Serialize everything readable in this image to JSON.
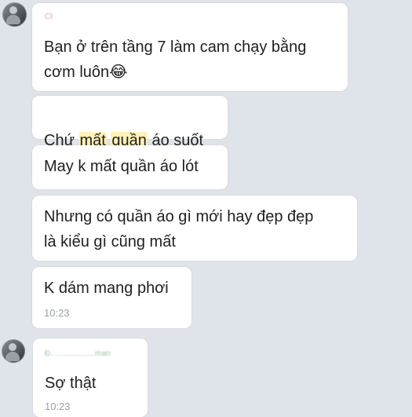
{
  "chat": {
    "messages": [
      {
        "sender_name": "Cł",
        "text": "Bạn ở trên tầng 7 làm cam chạy bằng\ncơm luôn😂"
      },
      {
        "text_before": "Chứ ",
        "highlight_1": "mất",
        "text_middle": " ",
        "highlight_2": "quần",
        "text_after": " áo suốt"
      },
      {
        "text": "May k mất quần áo lót"
      },
      {
        "text": "Nhưng có quần áo gì mới hay đẹp đẹp\nlà kiểu gì cũng mất"
      },
      {
        "text": "K dám mang phơi",
        "time": "10:23"
      },
      {
        "sender_name": "Đ...................man",
        "text": "Sợ thật",
        "time": "10:23"
      }
    ]
  },
  "colors": {
    "background": "#dfe3ea",
    "bubble": "#ffffff",
    "text": "#1f1f1f",
    "time": "#9aa1a8",
    "highlight": "#fff1b7",
    "sender_1": "#d77983",
    "sender_2": "#75b780"
  },
  "icons": {
    "avatar_1": "contact-avatar",
    "avatar_2": "contact-avatar"
  }
}
